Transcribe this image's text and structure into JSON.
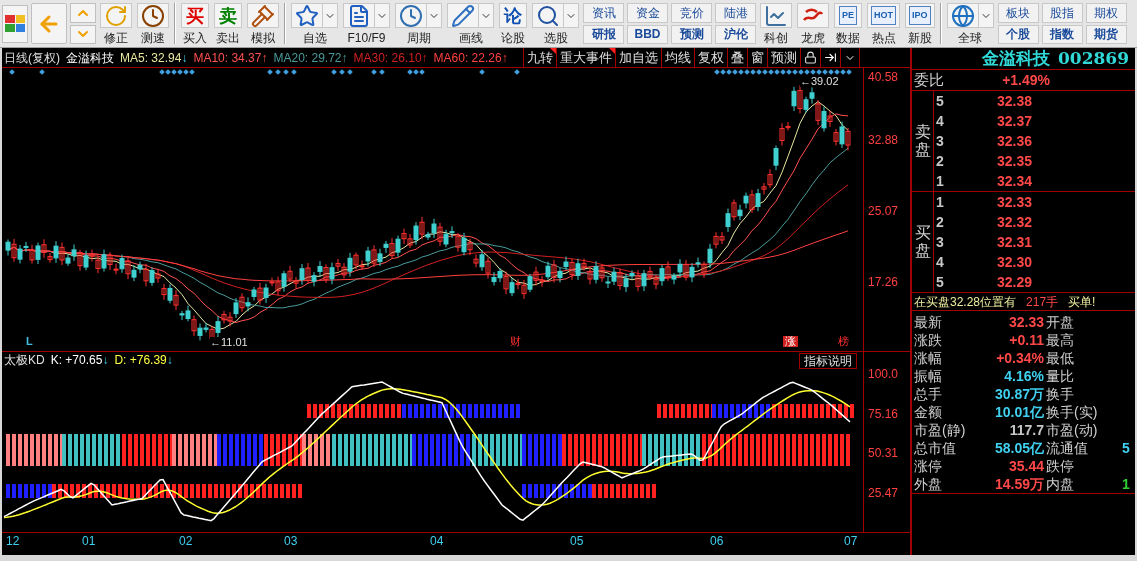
{
  "toolbar": [
    {
      "kind": "logo"
    },
    {
      "kind": "back"
    },
    {
      "kind": "updown"
    },
    {
      "kind": "tool",
      "label": "修正"
    },
    {
      "kind": "tool",
      "label": "测速"
    },
    {
      "kind": "separator"
    },
    {
      "kind": "tool",
      "label": "买入",
      "glyph": "买"
    },
    {
      "kind": "tool",
      "label": "卖出",
      "glyph": "卖"
    },
    {
      "kind": "tool",
      "label": "模拟"
    },
    {
      "kind": "separator"
    },
    {
      "kind": "tool",
      "label": "自选",
      "dropdown": true
    },
    {
      "kind": "tool",
      "label": "F10/F9",
      "dropdown": true
    },
    {
      "kind": "tool",
      "label": "周期",
      "dropdown": true
    },
    {
      "kind": "tool",
      "label": "画线",
      "dropdown": true
    },
    {
      "kind": "tool",
      "label": "论股",
      "glyph": "论"
    },
    {
      "kind": "tool",
      "label": "选股",
      "dropdown": true
    },
    {
      "kind": "pair",
      "top": "资讯",
      "bottom": "研报"
    },
    {
      "kind": "pair",
      "top": "资金",
      "bottom": "BBD"
    },
    {
      "kind": "pair",
      "top": "竞价",
      "bottom": "预测"
    },
    {
      "kind": "pair",
      "top": "陆港",
      "bottom": "沪伦"
    },
    {
      "kind": "tool",
      "label": "科创"
    },
    {
      "kind": "tool",
      "label": "龙虎"
    },
    {
      "kind": "tool",
      "label": "数据",
      "glyph": "PE"
    },
    {
      "kind": "tool",
      "label": "热点",
      "glyph": "HOT"
    },
    {
      "kind": "tool",
      "label": "新股",
      "glyph": "IPO"
    },
    {
      "kind": "separator"
    },
    {
      "kind": "tool",
      "label": "全球",
      "dropdown": true
    },
    {
      "kind": "pair",
      "top": "板块",
      "bottom": "个股"
    },
    {
      "kind": "pair",
      "top": "股指",
      "bottom": "指数"
    },
    {
      "kind": "pair",
      "top": "期权",
      "bottom": "期货"
    }
  ],
  "chart_header": {
    "period": "日线(复权)",
    "stock": "金溢科技",
    "ma": [
      {
        "label": "MA5:",
        "value": "32.94",
        "arrow": "↓",
        "falling": true,
        "color": "#e8e8a0"
      },
      {
        "label": "MA10:",
        "value": "34.37",
        "arrow": "↑",
        "falling": false,
        "color": "#ff5050"
      },
      {
        "label": "MA20:",
        "value": "29.72",
        "arrow": "↑",
        "falling": false,
        "color": "#4a9a9a"
      },
      {
        "label": "MA30:",
        "value": "26.10",
        "arrow": "↑",
        "falling": false,
        "color": "#d02020"
      },
      {
        "label": "MA60:",
        "value": "22.26",
        "arrow": "↑",
        "falling": false,
        "color": "#ff4040"
      }
    ]
  },
  "chart_buttons": [
    {
      "label": "九转",
      "flagged": true
    },
    {
      "label": "重大事件",
      "flagged": true
    },
    {
      "label": "加自选",
      "flagged": false
    },
    {
      "label": "均线",
      "flagged": false
    },
    {
      "label": "复权",
      "flagged": false
    },
    {
      "label": "叠",
      "flagged": false
    },
    {
      "label": "窗",
      "flagged": false
    },
    {
      "label": "预测",
      "flagged": false
    }
  ],
  "price_axis": [
    "40.58",
    "32.88",
    "25.07",
    "17.26"
  ],
  "chart_markers": [
    {
      "kind": "price",
      "text": "←39.02"
    },
    {
      "kind": "flag",
      "text": "L"
    },
    {
      "kind": "price",
      "text": "←11.01"
    },
    {
      "kind": "event",
      "text": "财"
    },
    {
      "kind": "badge",
      "text": "涨"
    },
    {
      "kind": "event",
      "text": "榜"
    }
  ],
  "indicator": {
    "name": "太极KD",
    "lines": [
      {
        "label": "K:",
        "value": "+70.65",
        "arrow": "↓",
        "falling": true,
        "color": "#ffffff"
      },
      {
        "label": "D:",
        "value": "+76.39",
        "arrow": "↓",
        "falling": true,
        "color": "#ffff40"
      }
    ],
    "help_button": "指标说明",
    "axis": [
      "100.0",
      "75.16",
      "50.31",
      "25.47"
    ]
  },
  "date_axis": [
    "12",
    "01",
    "02",
    "03",
    "04",
    "05",
    "06",
    "07"
  ],
  "quote": {
    "name": "金溢科技",
    "code": "002869",
    "ratio_label": "委比",
    "ratio": "+1.49%",
    "sell_label": "卖盘",
    "sell": [
      {
        "level": "5",
        "price": "32.38"
      },
      {
        "level": "4",
        "price": "32.37"
      },
      {
        "level": "3",
        "price": "32.36"
      },
      {
        "level": "2",
        "price": "32.35"
      },
      {
        "level": "1",
        "price": "32.34"
      }
    ],
    "buy_label": "买盘",
    "buy": [
      {
        "level": "1",
        "price": "32.33"
      },
      {
        "level": "2",
        "price": "32.32"
      },
      {
        "level": "3",
        "price": "32.31"
      },
      {
        "level": "4",
        "price": "32.30"
      },
      {
        "level": "5",
        "price": "32.29"
      }
    ],
    "alert": {
      "text": "在买盘32.28位置有",
      "volume": "217手",
      "action": "买单!"
    },
    "stats": [
      {
        "label": "最新",
        "value": "32.33",
        "color": "#ff4848",
        "right_label": "开盘"
      },
      {
        "label": "涨跌",
        "value": "+0.11",
        "color": "#ff4848",
        "right_label": "最高"
      },
      {
        "label": "涨幅",
        "value": "+0.34%",
        "color": "#ff4848",
        "right_label": "最低"
      },
      {
        "label": "振幅",
        "value": "4.16%",
        "color": "#40d0f0",
        "right_label": "量比"
      },
      {
        "label": "总手",
        "value": "30.87万",
        "color": "#40d0f0",
        "right_label": "换手"
      },
      {
        "label": "金额",
        "value": "10.01亿",
        "color": "#40d0f0",
        "right_label": "换手(实)"
      },
      {
        "label": "市盈(静)",
        "value": "117.7",
        "color": "#c8c8c8",
        "right_label": "市盈(动)"
      },
      {
        "label": "总市值",
        "value": "58.05亿",
        "color": "#40d0f0",
        "right_label": "流通值",
        "right_value": {
          "text": "5",
          "color": "#40d0f0"
        }
      },
      {
        "label": "涨停",
        "value": "35.44",
        "color": "#ff4848",
        "right_label": "跌停"
      },
      {
        "label": "外盘",
        "value": "14.59万",
        "color": "#ff4848",
        "right_label": "内盘",
        "right_value": {
          "text": "1",
          "color": "#30d030"
        }
      }
    ]
  }
}
